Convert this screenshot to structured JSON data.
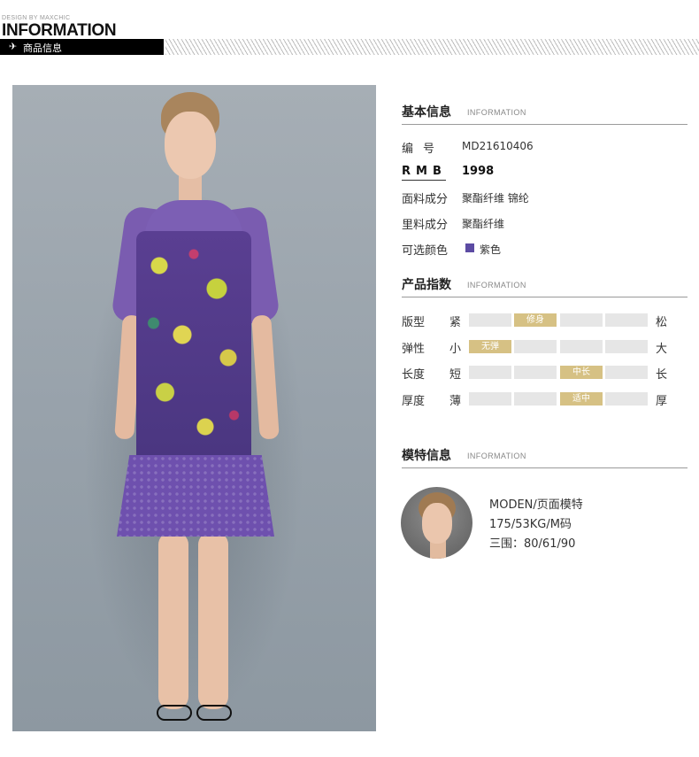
{
  "header": {
    "brand_small": "DESIGN BY MAXCHIC",
    "brand_big": "INFORMATION",
    "bar_label": "商品信息",
    "bar_icon": "plane-icon"
  },
  "basic": {
    "title": "基本信息",
    "subtitle": "INFORMATION",
    "code_label": "编号",
    "code_value": "MD21610406",
    "rmb_label": "RMB",
    "rmb_value": "1998",
    "fabric_label": "面料成分",
    "fabric_value": "聚酯纤维 锦纶",
    "lining_label": "里料成分",
    "lining_value": "聚酯纤维",
    "color_label": "可选颜色",
    "color_value": "紫色",
    "color_swatch": "#5c4ba3"
  },
  "index": {
    "title": "产品指数",
    "subtitle": "INFORMATION",
    "rows": [
      {
        "label": "版型",
        "min": "紧",
        "max": "松",
        "cells": [
          "",
          "修身",
          "",
          ""
        ],
        "active": 1
      },
      {
        "label": "弹性",
        "min": "小",
        "max": "大",
        "cells": [
          "无弹",
          "",
          "",
          ""
        ],
        "active": 0
      },
      {
        "label": "长度",
        "min": "短",
        "max": "长",
        "cells": [
          "",
          "",
          "中长",
          ""
        ],
        "active": 2
      },
      {
        "label": "厚度",
        "min": "薄",
        "max": "厚",
        "cells": [
          "",
          "",
          "适中",
          ""
        ],
        "active": 2
      }
    ],
    "active_color": "#d6c184",
    "inactive_color": "#e6e6e6"
  },
  "model": {
    "title": "模特信息",
    "subtitle": "INFORMATION",
    "line1": "MODEN/页面模特",
    "line2": "175/53KG/M码",
    "line3": "三围：80/61/90"
  }
}
